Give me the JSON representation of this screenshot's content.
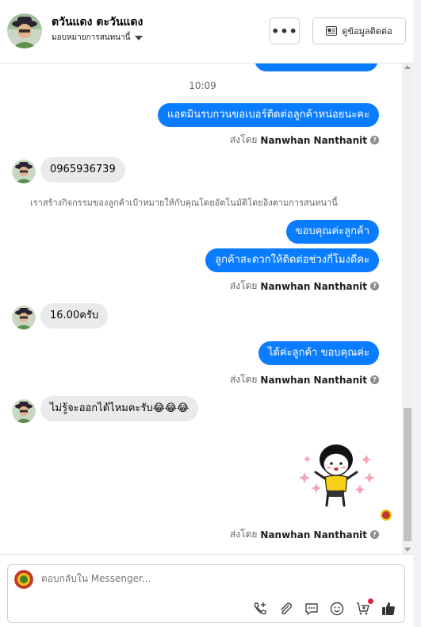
{
  "header": {
    "name": "ตวันแดง ตะวันแดง",
    "assign_label": "มอบหมายการสนทนานี้",
    "more_label": "•••",
    "contact_label": "ดูข้อมูลติดต่อ"
  },
  "messages": {
    "timestamp": "10:09",
    "m1": "แอดมินรบกวนขอเบอร์ติดต่อลูกค้าหน่อยนะคะ",
    "m2": "0965936739",
    "system_note": "เราสร้างกิจกรรมของลูกค้าเป้าหมายให้กับคุณโดยอัตโนมัติโดยอิงตามการสนทนานี้",
    "m3": "ขอบคุณค่ะลูกค้า",
    "m4": "ลูกค้าสะดวกให้ติดต่อช่วงกี่โมงดีคะ",
    "m5": "16.00ครับ",
    "m6": "ได้ค่ะลูกค้า ขอบคุณค่ะ",
    "m7": "ไม่รู้จะออกได้ไหมคะรับ😂😂😂"
  },
  "sent_by": {
    "prefix": "ส่งโดย",
    "agent": "Nanwhan Nanthanit",
    "info": "?"
  },
  "composer": {
    "placeholder": "ตอบกลับใน Messenger..."
  },
  "colors": {
    "outgoing": "#0a7cff",
    "incoming": "#e9eaeb",
    "badge": "#e41e3f"
  }
}
